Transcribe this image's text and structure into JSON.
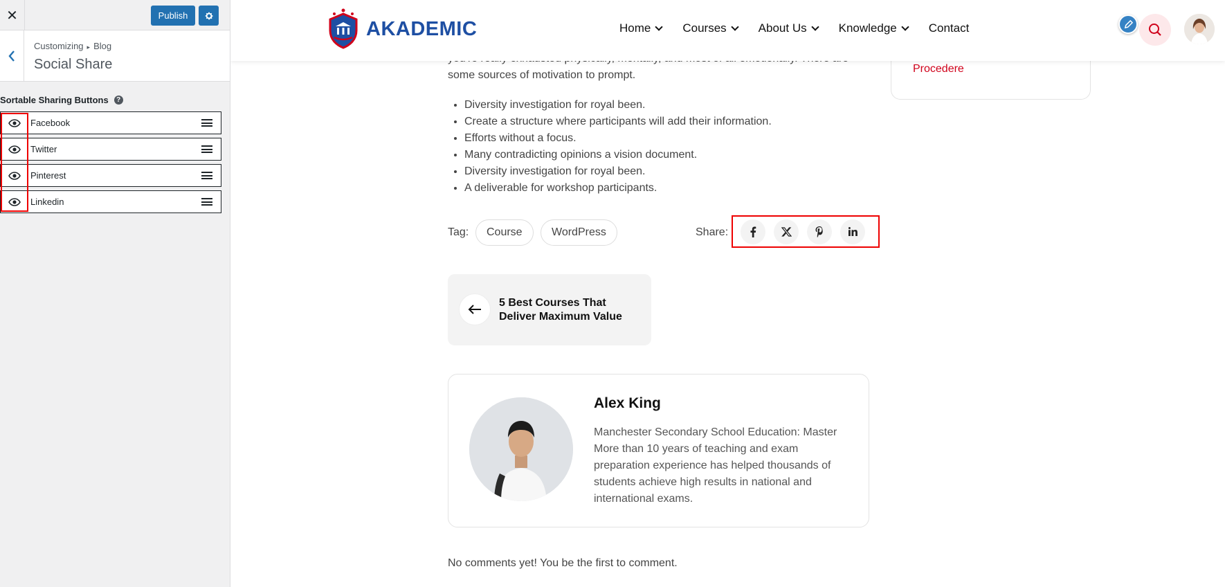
{
  "customizer": {
    "close_glyph": "✕",
    "publish_label": "Publish",
    "breadcrumb": [
      "Customizing",
      "Blog"
    ],
    "breadcrumb_sep": "▸",
    "section_title": "Social Share",
    "sortable_label": "Sortable Sharing Buttons",
    "help_glyph": "?",
    "items": [
      {
        "label": "Facebook",
        "visible": true
      },
      {
        "label": "Twitter",
        "visible": true
      },
      {
        "label": "Pinterest",
        "visible": true
      },
      {
        "label": "Linkedin",
        "visible": true
      }
    ],
    "accent": "#2271b1"
  },
  "header": {
    "logo_text": "AKADEMIC",
    "nav": [
      {
        "label": "Home",
        "dropdown": true
      },
      {
        "label": "Courses",
        "dropdown": true
      },
      {
        "label": "About Us",
        "dropdown": true
      },
      {
        "label": "Knowledge",
        "dropdown": true
      },
      {
        "label": "Contact",
        "dropdown": false
      }
    ],
    "brand_color": "#1e4fa3",
    "search_accent": "#d0021b"
  },
  "article": {
    "para_cut": "you're really exhausted physically, mentally, and most of all emotionally. There are some sources of motivation to prompt.",
    "bullets": [
      "Diversity investigation for royal been.",
      "Create a structure where participants will add their information.",
      "Efforts without a focus.",
      "Many contradicting opinions a vision document.",
      "Diversity investigation for royal been.",
      "A deliverable for workshop participants."
    ],
    "tag_label": "Tag:",
    "tags": [
      "Course",
      "WordPress"
    ],
    "share_label": "Share:",
    "share_icons": [
      "facebook-icon",
      "x-twitter-icon",
      "pinterest-icon",
      "linkedin-icon"
    ],
    "share_glyphs": [
      "f",
      "𝕏",
      "P",
      "in"
    ],
    "prev_post_title": "5 Best Courses That Deliver Maximum Value",
    "author": {
      "name": "Alex King",
      "bio": "Manchester Secondary School Education: Master More than 10 years of teaching and exam preparation experience has helped thousands of students achieve high results in national and international exams."
    },
    "comments_note": "No comments yet! You be the first to comment."
  },
  "sidebar": {
    "link_label": "Procedere"
  }
}
